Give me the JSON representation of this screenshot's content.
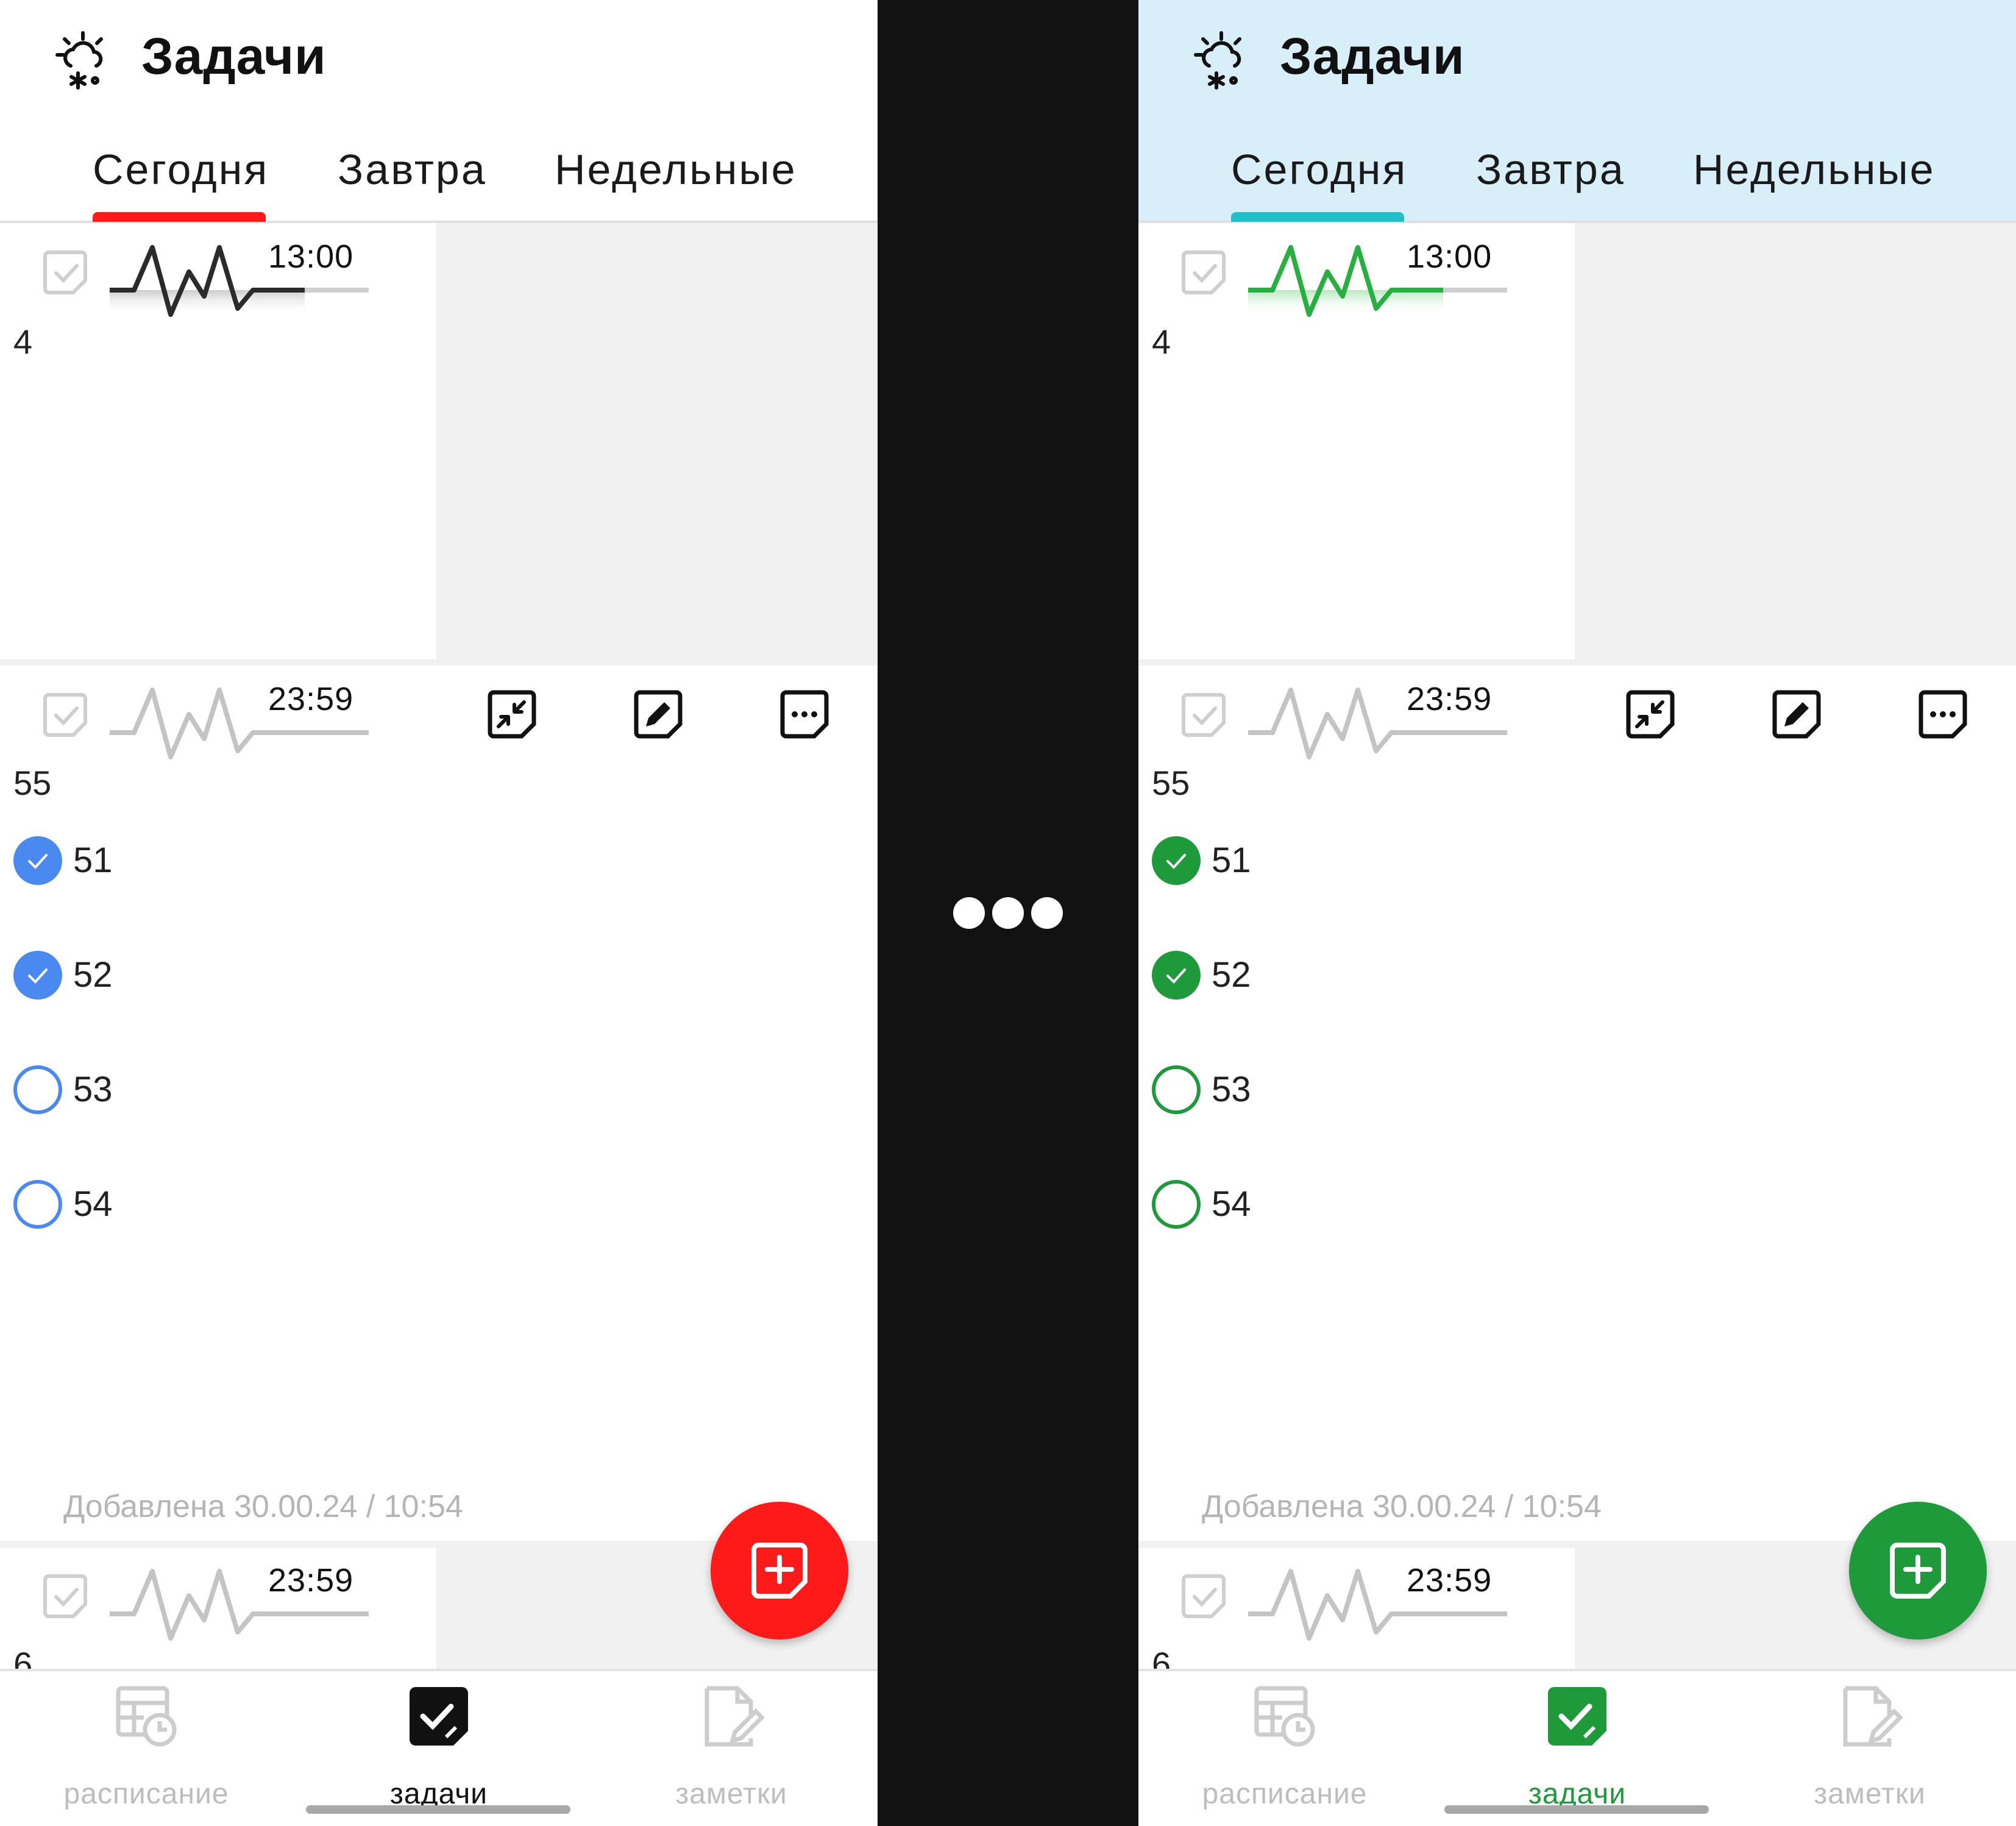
{
  "app": {
    "title": "Задачи"
  },
  "tabs": [
    "Сегодня",
    "Завтра",
    "Недельные"
  ],
  "tasks": [
    {
      "time": "13:00",
      "title": "4"
    },
    {
      "time": "23:59",
      "title": "55",
      "added": "Добавлена 30.00.24 / 10:54",
      "subtasks": [
        {
          "label": "51",
          "done": true
        },
        {
          "label": "52",
          "done": true
        },
        {
          "label": "53",
          "done": false
        },
        {
          "label": "54",
          "done": false
        }
      ]
    },
    {
      "time": "23:59",
      "title": "6"
    }
  ],
  "card_actions": [
    "collapse-icon",
    "edit-icon",
    "more-icon"
  ],
  "fab_icon": "add-note-icon",
  "nav": [
    {
      "label": "расписание",
      "icon": "schedule-icon"
    },
    {
      "label": "задачи",
      "icon": "tasks-icon",
      "active": true
    },
    {
      "label": "заметки",
      "icon": "notes-icon"
    }
  ],
  "themes": {
    "left": {
      "accent": "#ff1a1a",
      "check": "#4a8af0",
      "pulse": "#2b2b2b"
    },
    "right": {
      "accent": "#1e9a3a",
      "check": "#1e9a3a",
      "pulse": "#27b040",
      "header_bg": "#d8eef8",
      "tab_indicator": "#20c0c8"
    }
  },
  "divider_icon": "more-dots-icon"
}
